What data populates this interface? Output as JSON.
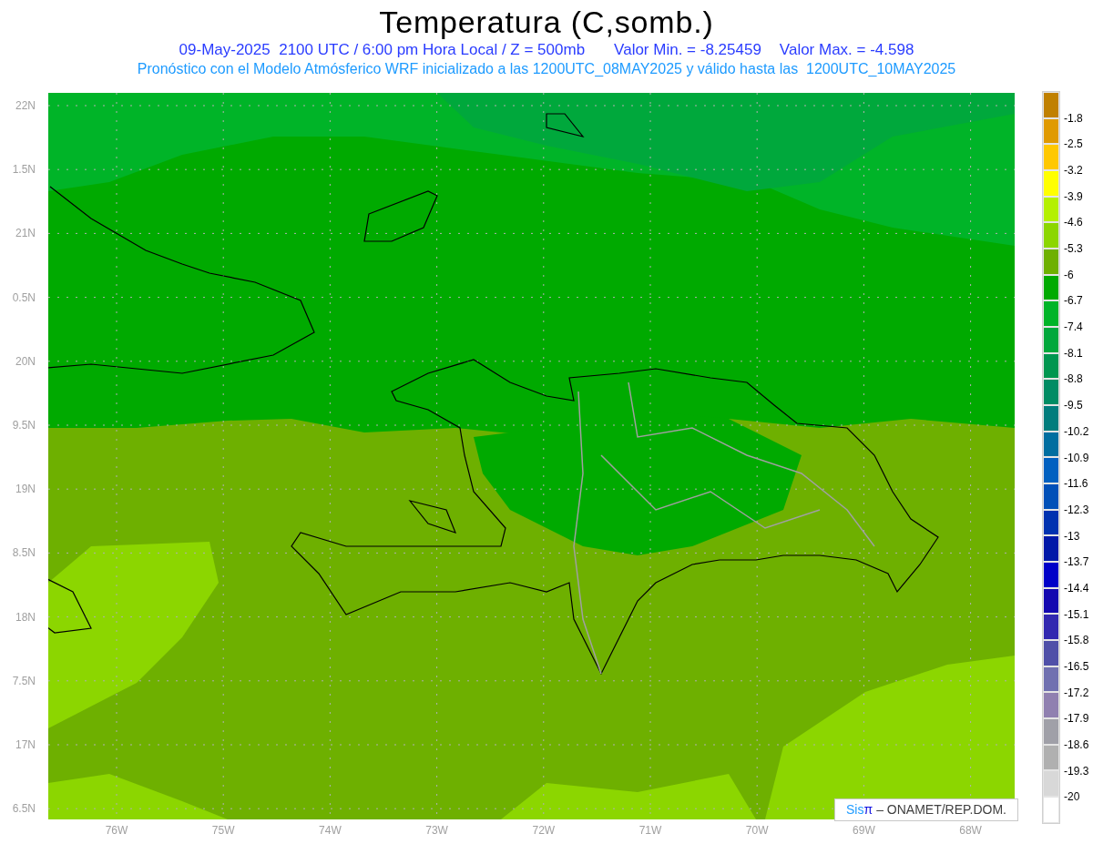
{
  "title": "Temperatura (C,somb.)",
  "subtitle": {
    "date_line": "09-May-2025  2100 UTC / 6:00 pm Hora Local / Z = 500mb",
    "min": "Valor Min. = -8.25459",
    "max": "Valor Max. = -4.598"
  },
  "model_line": "Pronóstico con el Modelo Atmósferico WRF inicializado a las 1200UTC_08MAY2025 y válido hasta las  1200UTC_10MAY2025",
  "y_labels": [
    "22N",
    "1.5N",
    "21N",
    "0.5N",
    "20N",
    "9.5N",
    "19N",
    "8.5N",
    "18N",
    "7.5N",
    "17N",
    "6.5N"
  ],
  "x_labels": [
    "76W",
    "75W",
    "74W",
    "73W",
    "72W",
    "71W",
    "70W",
    "69W",
    "68W"
  ],
  "legend": {
    "swatches": [
      {
        "color": "#c08000"
      },
      {
        "color": "#e09a00"
      },
      {
        "color": "#ffc800"
      },
      {
        "color": "#ffff00"
      },
      {
        "color": "#b4f000"
      },
      {
        "color": "#8cd600"
      },
      {
        "color": "#6eb000"
      },
      {
        "color": "#00aa00"
      },
      {
        "color": "#00b428"
      },
      {
        "color": "#00a83c"
      },
      {
        "color": "#009650"
      },
      {
        "color": "#008c64"
      },
      {
        "color": "#007d7d"
      },
      {
        "color": "#006ea0"
      },
      {
        "color": "#0060c0"
      },
      {
        "color": "#0050b8"
      },
      {
        "color": "#0032b0"
      },
      {
        "color": "#0018a8"
      },
      {
        "color": "#0000c8"
      },
      {
        "color": "#1408b0"
      },
      {
        "color": "#3228b0"
      },
      {
        "color": "#5050a8"
      },
      {
        "color": "#7070b0"
      },
      {
        "color": "#9080b0"
      },
      {
        "color": "#a0a0a8"
      },
      {
        "color": "#b0b0b0"
      },
      {
        "color": "#d8d8d8"
      },
      {
        "color": "#ffffff"
      }
    ],
    "labels": [
      "-1.8",
      "-2.5",
      "-3.2",
      "-3.9",
      "-4.6",
      "-5.3",
      "-6",
      "-6.7",
      "-7.4",
      "-8.1",
      "-8.8",
      "-9.5",
      "-10.2",
      "-10.9",
      "-11.6",
      "-12.3",
      "-13",
      "-13.7",
      "-14.4",
      "-15.1",
      "-15.8",
      "-16.5",
      "-17.2",
      "-17.9",
      "-18.6",
      "-19.3",
      "-20"
    ]
  },
  "attribution": {
    "brand": "Sis",
    "symbol": "π",
    "text": "– ONAMET/REP.DOM."
  }
}
